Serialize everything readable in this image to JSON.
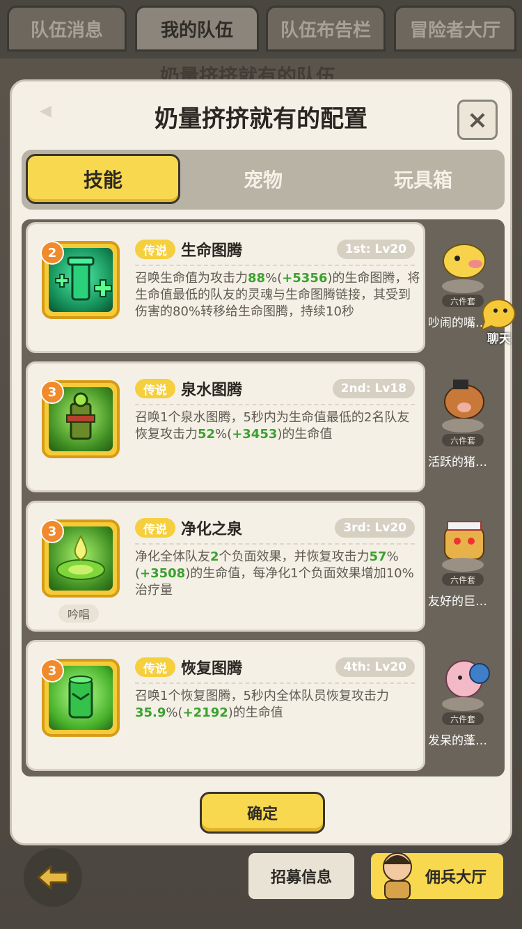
{
  "top_tabs": [
    "队伍消息",
    "我的队伍",
    "队伍布告栏",
    "冒险者大厅"
  ],
  "top_tab_active": 1,
  "behind_title": "奶量挤挤就有的队伍",
  "modal": {
    "title": "奶量挤挤就有的配置",
    "close_symbol": "×",
    "tabs": [
      "技能",
      "宠物",
      "玩具箱"
    ],
    "active_tab": 0,
    "confirm_label": "确定"
  },
  "skills": [
    {
      "badge": "2",
      "rarity": "传说",
      "name": "生命图腾",
      "rank": "1st: Lv20",
      "desc_parts": [
        {
          "t": "召唤生命值为攻击力"
        },
        {
          "t": "88",
          "hl": true
        },
        {
          "t": "%("
        },
        {
          "t": "+5356",
          "hl": true
        },
        {
          "t": ")的生命图腾，将生命值最低的队友的灵魂与生命图腾链接，其受到伤害的80%转移给生命图腾，持续10秒"
        }
      ],
      "tag": ""
    },
    {
      "badge": "3",
      "rarity": "传说",
      "name": "泉水图腾",
      "rank": "2nd: Lv18",
      "desc_parts": [
        {
          "t": "召唤1个泉水图腾，5秒内为生命值最低的2名队友恢复攻击力"
        },
        {
          "t": "52",
          "hl": true
        },
        {
          "t": "%("
        },
        {
          "t": "+3453",
          "hl": true
        },
        {
          "t": ")的生命值"
        }
      ],
      "tag": ""
    },
    {
      "badge": "3",
      "rarity": "传说",
      "name": "净化之泉",
      "rank": "3rd: Lv20",
      "desc_parts": [
        {
          "t": "净化全体队友"
        },
        {
          "t": "2",
          "hl": true
        },
        {
          "t": "个负面效果，并恢复攻击力"
        },
        {
          "t": "57",
          "hl": true
        },
        {
          "t": "%("
        },
        {
          "t": "+3508",
          "hl": true
        },
        {
          "t": ")的生命值，每净化1个负面效果增加10%治疗量"
        }
      ],
      "tag": "吟唱"
    },
    {
      "badge": "3",
      "rarity": "传说",
      "name": "恢复图腾",
      "rank": "4th: Lv20",
      "desc_parts": [
        {
          "t": "召唤1个恢复图腾，5秒内全体队员恢复攻击力"
        },
        {
          "t": "35.9",
          "hl": true
        },
        {
          "t": "%("
        },
        {
          "t": "+2192",
          "hl": true
        },
        {
          "t": ")的生命值"
        }
      ],
      "tag": ""
    }
  ],
  "side_pets": [
    {
      "set_tag": "六件套",
      "name": "吵闹的嘴…"
    },
    {
      "set_tag": "六件套",
      "name": "活跃的猪…"
    },
    {
      "set_tag": "六件套",
      "name": "友好的巨…"
    },
    {
      "set_tag": "六件套",
      "name": "发呆的蓬…"
    }
  ],
  "chat": {
    "label": "聊天"
  },
  "bottom": {
    "back_icon": "arrow-left-icon",
    "recruit_label": "招募信息",
    "mercenary_label": "佣兵大厅"
  },
  "colors": {
    "accent_yellow": "#f7d84f",
    "highlight_green": "#3aa12e",
    "rarity_badge": "#f5cf3d",
    "level_badge": "#f08a2c"
  }
}
